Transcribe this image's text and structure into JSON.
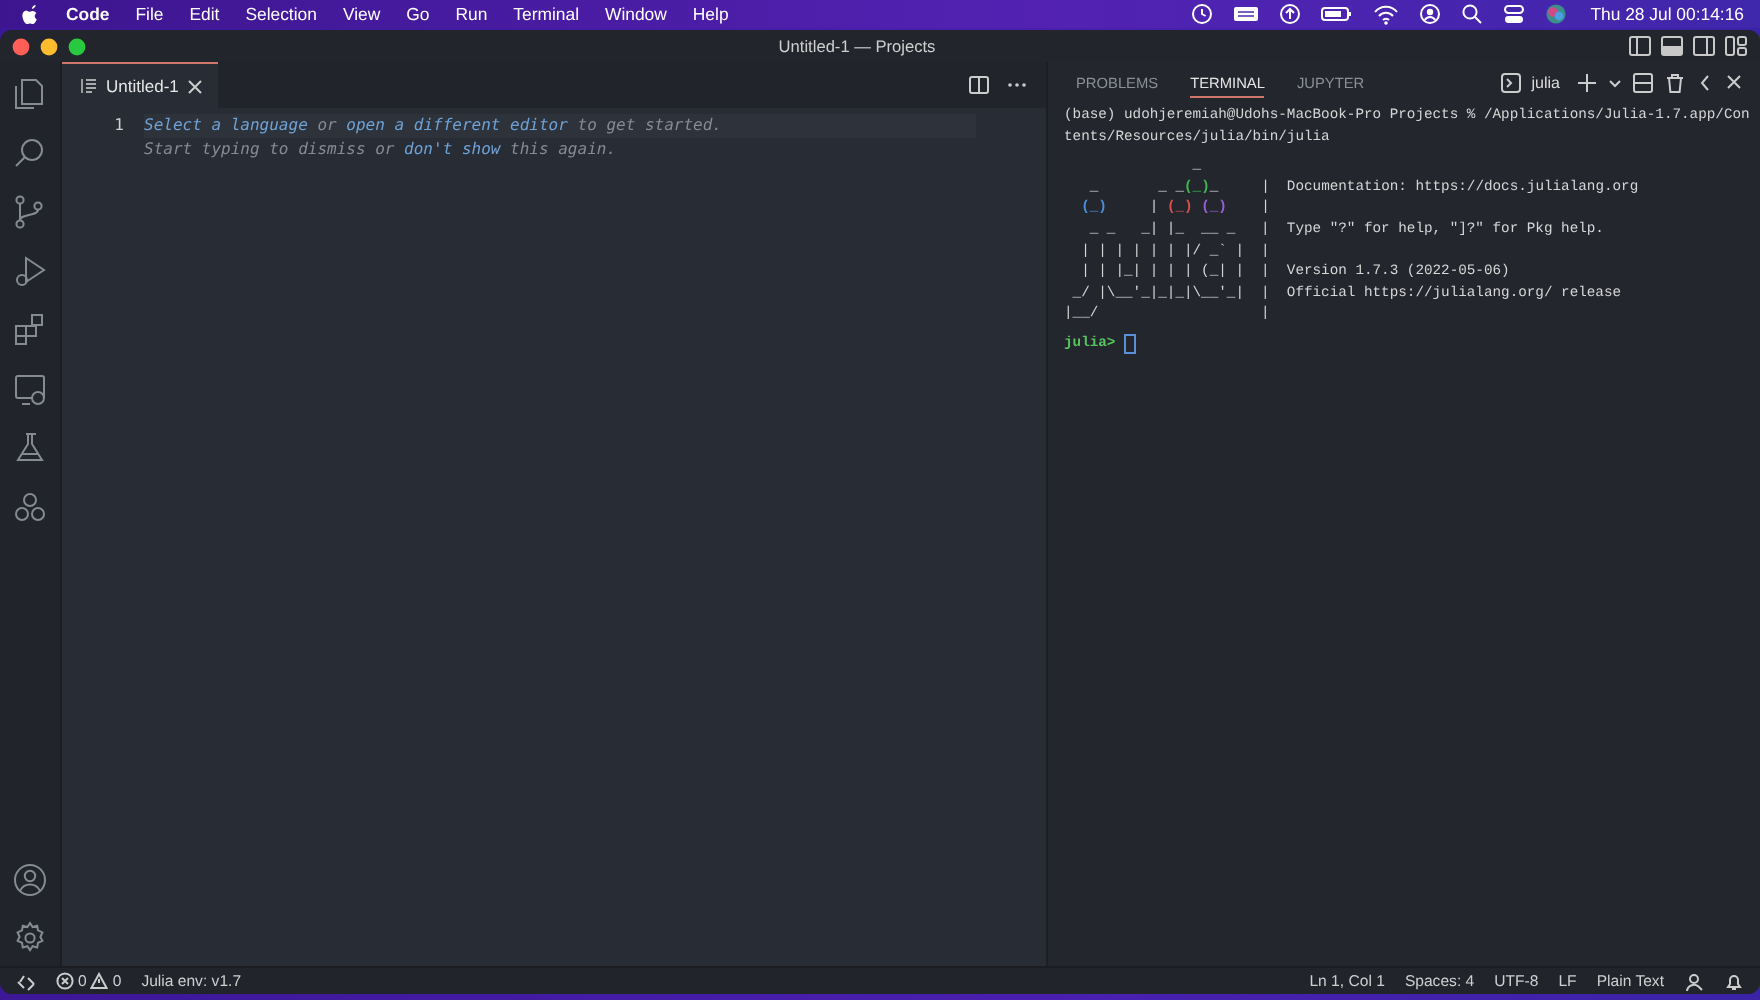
{
  "menu_bar": {
    "app": "Code",
    "items": [
      "File",
      "Edit",
      "Selection",
      "View",
      "Go",
      "Run",
      "Terminal",
      "Window",
      "Help"
    ],
    "clock": "Thu 28 Jul  00:14:16"
  },
  "window": {
    "title": "Untitled-1 — Projects"
  },
  "activity_bar": {
    "items": [
      {
        "kind": "files",
        "selected": false
      },
      {
        "kind": "search",
        "selected": false
      },
      {
        "kind": "source-control",
        "selected": false
      },
      {
        "kind": "run",
        "selected": false
      },
      {
        "kind": "extensions",
        "selected": false
      },
      {
        "kind": "remote",
        "selected": false
      },
      {
        "kind": "flask",
        "selected": false
      },
      {
        "kind": "circles",
        "selected": false
      }
    ]
  },
  "editor": {
    "tabs": [
      {
        "label": "Untitled-1",
        "selected": true
      }
    ],
    "line_numbers": [
      "1"
    ],
    "hint_lines": [
      [
        {
          "kind": "link",
          "text": "Select a language"
        },
        {
          "kind": "text",
          "text": " or "
        },
        {
          "kind": "link",
          "text": "open a different editor"
        },
        {
          "kind": "text",
          "text": " to get started."
        }
      ],
      [
        {
          "kind": "text",
          "text": "Start typing to dismiss or "
        },
        {
          "kind": "link",
          "text": "don't show"
        },
        {
          "kind": "text",
          "text": " this again."
        }
      ]
    ]
  },
  "panel": {
    "tabs": [
      {
        "label": "PROBLEMS",
        "selected": false
      },
      {
        "label": "TERMINAL",
        "selected": true
      },
      {
        "label": "JUPYTER",
        "selected": false
      }
    ],
    "terminal_name": "julia",
    "command_lines": [
      "(base) udohjeremiah@Udohs-MacBook-Pro Projects % /Applications/Julia-1.7.app/Con",
      "tents/Resources/julia/bin/julia"
    ],
    "banner": [
      {
        "art": [
          {
            "text": "               _"
          }
        ]
      },
      {
        "art": [
          {
            "text": "   _       _ _"
          },
          {
            "text": "(_)",
            "color": "#3fb950"
          },
          {
            "text": "_     |"
          }
        ],
        "info": "Documentation: https://docs.julialang.org"
      },
      {
        "art": [
          {
            "text": "  (_)",
            "color": "#4d8fd6"
          },
          {
            "text": "     | "
          },
          {
            "text": "(_)",
            "color": "#d65050"
          },
          {
            "text": " (_)",
            "color": "#9a5fd6"
          },
          {
            "text": "    |"
          }
        ]
      },
      {
        "art": [
          {
            "text": "   _ _   _| |_  __ _   |"
          }
        ],
        "info": "Type \"?\" for help, \"]?\" for Pkg help."
      },
      {
        "art": [
          {
            "text": "  | | | | | | |/ _` |  |"
          }
        ]
      },
      {
        "art": [
          {
            "text": "  | | |_| | | | (_| |  |"
          }
        ],
        "info": "Version 1.7.3 (2022-05-06)"
      },
      {
        "art": [
          {
            "text": " _/ |\\__'_|_|_|\\__'_|  |"
          }
        ],
        "info": "Official https://julialang.org/ release"
      },
      {
        "art": [
          {
            "text": "|__/                   |"
          }
        ]
      }
    ],
    "prompt": "julia>"
  },
  "status_bar": {
    "errors": "0",
    "warnings": "0",
    "left_items": [
      "Julia env: v1.7"
    ],
    "right_items": [
      "Ln 1, Col 1",
      "Spaces: 4",
      "UTF-8",
      "LF",
      "Plain Text"
    ]
  }
}
